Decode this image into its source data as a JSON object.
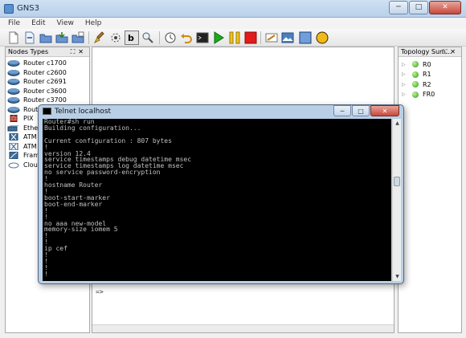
{
  "app": {
    "title": "GNS3",
    "icon": "gns3-icon"
  },
  "window_controls": {
    "minimize": "─",
    "maximize": "□",
    "close": "✕"
  },
  "menu": [
    "File",
    "Edit",
    "View",
    "Help"
  ],
  "toolbar": {
    "icons": [
      "new-file-icon",
      "open-file-icon",
      "open-folder-icon",
      "save-icon",
      "save-as-icon",
      "clean-icon",
      "snapshot-icon",
      "label-toggle-icon",
      "zoom-icon",
      "timer-icon",
      "undo-icon",
      "console-icon",
      "start-icon",
      "pause-icon",
      "stop-icon",
      "note-icon",
      "image-icon",
      "rectangle-icon",
      "ellipse-icon"
    ]
  },
  "nodes_panel": {
    "title": "Nodes Types",
    "controls": "⛶✕",
    "items": [
      {
        "label": "Router c1700",
        "icon": "router-icon"
      },
      {
        "label": "Router c2600",
        "icon": "router-icon"
      },
      {
        "label": "Router c2691",
        "icon": "router-icon"
      },
      {
        "label": "Router c3600",
        "icon": "router-icon"
      },
      {
        "label": "Router c3700",
        "icon": "router-icon"
      },
      {
        "label": "Rout",
        "icon": "router-icon"
      },
      {
        "label": "PIX",
        "icon": "firewall-icon"
      },
      {
        "label": "Ethe",
        "icon": "switch-icon"
      },
      {
        "label": "ATM",
        "icon": "atm-switch-icon"
      },
      {
        "label": "ATM",
        "icon": "atm-bridge-icon"
      },
      {
        "label": "Fram",
        "icon": "frame-relay-icon"
      },
      {
        "label": "Clou",
        "icon": "cloud-icon"
      }
    ]
  },
  "workarea": {
    "prompt": "=>"
  },
  "topology_panel": {
    "title": "Topology Sum...",
    "controls": "⛶✕",
    "items": [
      {
        "label": "R0",
        "status_color": "#2c9a12"
      },
      {
        "label": "R1",
        "status_color": "#2c9a12"
      },
      {
        "label": "R2",
        "status_color": "#2c9a12"
      },
      {
        "label": "FR0",
        "status_color": "#2c9a12"
      }
    ]
  },
  "telnet": {
    "title": "Telnet localhost",
    "lines": [
      "Router#sh run",
      "Building configuration...",
      "",
      "Current configuration : 807 bytes",
      "!",
      "version 12.4",
      "service timestamps debug datetime msec",
      "service timestamps log datetime msec",
      "no service password-encryption",
      "!",
      "hostname Router",
      "!",
      "boot-start-marker",
      "boot-end-marker",
      "!",
      "!",
      "no aaa new-model",
      "memory-size iomem 5",
      "!",
      "!",
      "ip cef",
      "!",
      "!",
      "!",
      "!"
    ]
  }
}
